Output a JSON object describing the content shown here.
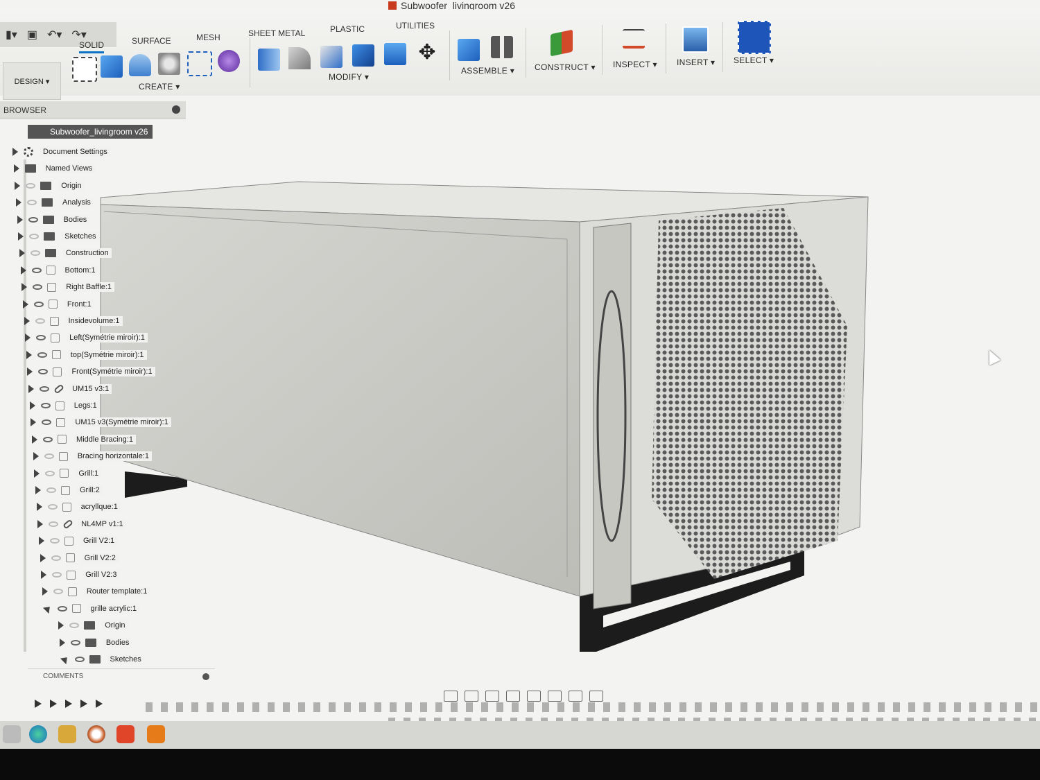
{
  "app": {
    "window_title": "Subwoofer_livingroom v26"
  },
  "quick_access": {
    "file_icon": "file-icon",
    "save_icon": "save-icon",
    "undo_icon": "undo-icon",
    "redo_icon": "redo-icon"
  },
  "workspace": {
    "label": "DESIGN ▾"
  },
  "tabs": [
    {
      "label": "SOLID",
      "active": true
    },
    {
      "label": "SURFACE"
    },
    {
      "label": "MESH"
    },
    {
      "label": "SHEET METAL"
    },
    {
      "label": "PLASTIC"
    },
    {
      "label": "UTILITIES"
    }
  ],
  "groups": {
    "create": "CREATE ▾",
    "modify": "MODIFY ▾",
    "assemble": "ASSEMBLE ▾",
    "construct": "CONSTRUCT ▾",
    "inspect": "INSPECT ▾",
    "insert": "INSERT ▾",
    "select": "SELECT ▾"
  },
  "colors": {
    "accent": "#0c72c7",
    "select_blue": "#1e55b8",
    "body_gray": "#c9c9c4",
    "grill_dark": "#4a4a4a",
    "legs": "#1c1c1c"
  },
  "browser": {
    "title": "BROWSER",
    "root": "Subwoofer_livingroom v26",
    "items": [
      {
        "label": "Document Settings",
        "icon": "gear-icon"
      },
      {
        "label": "Named Views",
        "icon": "folder-icon"
      },
      {
        "label": "Origin",
        "icon": "folder-icon"
      },
      {
        "label": "Analysis",
        "icon": "folder-icon"
      },
      {
        "label": "Bodies",
        "icon": "folder-icon"
      },
      {
        "label": "Sketches",
        "icon": "folder-icon"
      },
      {
        "label": "Construction",
        "icon": "folder-icon"
      },
      {
        "label": "Bottom:1",
        "icon": "body-icon"
      },
      {
        "label": "Right Baffle:1",
        "icon": "body-icon"
      },
      {
        "label": "Front:1",
        "icon": "body-icon"
      },
      {
        "label": "Insidevolume:1",
        "icon": "body-icon"
      },
      {
        "label": "Left(Symétrie miroir):1",
        "icon": "body-icon"
      },
      {
        "label": "top(Symétrie miroir):1",
        "icon": "body-icon"
      },
      {
        "label": "Front(Symétrie miroir):1",
        "icon": "body-icon"
      },
      {
        "label": "UM15 v3:1",
        "icon": "link-icon"
      },
      {
        "label": "Legs:1",
        "icon": "body-icon"
      },
      {
        "label": "UM15 v3(Symétrie miroir):1",
        "icon": "body-icon"
      },
      {
        "label": "Middle Bracing:1",
        "icon": "body-icon"
      },
      {
        "label": "Bracing horizontale:1",
        "icon": "body-icon"
      },
      {
        "label": "Grill:1",
        "icon": "body-icon"
      },
      {
        "label": "Grill:2",
        "icon": "body-icon"
      },
      {
        "label": "acryllque:1",
        "icon": "body-icon"
      },
      {
        "label": "NL4MP v1:1",
        "icon": "link-icon"
      },
      {
        "label": "Grill V2:1",
        "icon": "body-icon"
      },
      {
        "label": "Grill V2:2",
        "icon": "body-icon"
      },
      {
        "label": "Grill V2:3",
        "icon": "body-icon"
      },
      {
        "label": "Router template:1",
        "icon": "body-icon"
      },
      {
        "label": "grille acrylic:1",
        "icon": "body-icon"
      },
      {
        "label": "Origin",
        "icon": "folder-icon"
      },
      {
        "label": "Bodies",
        "icon": "folder-icon"
      },
      {
        "label": "Sketches",
        "icon": "folder-icon"
      }
    ]
  },
  "comments": {
    "label": "COMMENTS"
  }
}
